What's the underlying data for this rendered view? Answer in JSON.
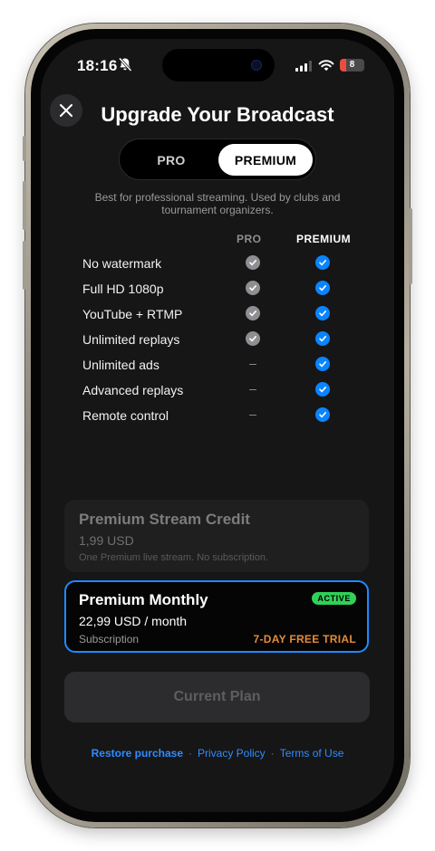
{
  "status_bar": {
    "time": "18:16",
    "battery_level": "8"
  },
  "header": {
    "title": "Upgrade Your Broadcast"
  },
  "plan_toggle": {
    "options": [
      "PRO",
      "PREMIUM"
    ],
    "selected": "PREMIUM"
  },
  "description": "Best for professional streaming. Used by clubs and tournament organizers.",
  "comparison": {
    "columns": [
      "PRO",
      "PREMIUM"
    ],
    "rows": [
      {
        "label": "No watermark",
        "pro": "check",
        "premium": "check"
      },
      {
        "label": "Full HD 1080p",
        "pro": "check",
        "premium": "check"
      },
      {
        "label": "YouTube + RTMP",
        "pro": "check",
        "premium": "check"
      },
      {
        "label": "Unlimited replays",
        "pro": "check",
        "premium": "check"
      },
      {
        "label": "Unlimited ads",
        "pro": "–",
        "premium": "check"
      },
      {
        "label": "Advanced replays",
        "pro": "–",
        "premium": "check"
      },
      {
        "label": "Remote control",
        "pro": "–",
        "premium": "check"
      }
    ]
  },
  "options": {
    "credit": {
      "title": "Premium Stream Credit",
      "price": "1,99 USD",
      "subtitle": "One Premium live stream. No subscription."
    },
    "monthly": {
      "title": "Premium Monthly",
      "price": "22,99 USD / month",
      "subtitle": "Subscription",
      "badge": "ACTIVE",
      "trial": "7-DAY FREE TRIAL"
    }
  },
  "cta": {
    "label": "Current Plan"
  },
  "footer": {
    "restore": "Restore purchase",
    "privacy": "Privacy Policy",
    "terms": "Terms of Use",
    "separator": "·"
  },
  "colors": {
    "accent": "#0a84ff",
    "active_badge": "#30d158",
    "trial": "#e58a3a",
    "background": "#161616"
  }
}
